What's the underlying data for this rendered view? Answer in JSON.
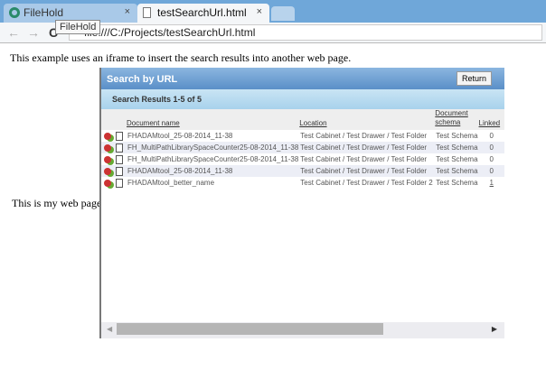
{
  "browser": {
    "tabs": [
      {
        "label": "FileHold",
        "icon": "filehold-logo-icon"
      },
      {
        "label": "testSearchUrl.html",
        "icon": "page-icon"
      }
    ],
    "tooltip": "FileHold",
    "url": "file:///C:/Projects/testSearchUrl.html",
    "close_glyph": "×",
    "back": "←",
    "forward": "→",
    "reload": "C"
  },
  "page": {
    "intro": "This example uses an iframe to insert the search results into another web page.",
    "side_text": "This is my web page!"
  },
  "frame": {
    "title": "Search by URL",
    "return_label": "Return",
    "results_label": "Search Results 1-5 of 5",
    "columns": [
      "Document name",
      "Location",
      "Document schema",
      "Linked"
    ],
    "rows": [
      {
        "name": "FHADAMtool_25-08-2014_11-38",
        "location": "Test Cabinet / Test Drawer / Test Folder",
        "schema": "Test Schema",
        "linked": "0"
      },
      {
        "name": "FH_MultiPathLibrarySpaceCounter25-08-2014_11-38",
        "location": "Test Cabinet / Test Drawer / Test Folder",
        "schema": "Test Schema",
        "linked": "0"
      },
      {
        "name": "FH_MultiPathLibrarySpaceCounter25-08-2014_11-38",
        "location": "Test Cabinet / Test Drawer / Test Folder",
        "schema": "Test Schema",
        "linked": "0"
      },
      {
        "name": "FHADAMtool_25-08-2014_11-38",
        "location": "Test Cabinet / Test Drawer / Test Folder",
        "schema": "Test Schema",
        "linked": "0"
      },
      {
        "name": "FHADAMtool_better_name",
        "location": "Test Cabinet / Test Drawer / Test Folder 2",
        "schema": "Test Schema",
        "linked": "1"
      }
    ]
  },
  "colors": {
    "header_blue": "#5a8fc8",
    "subheader": "#a8d2ec",
    "tab_bar": "#6fa7d9"
  }
}
